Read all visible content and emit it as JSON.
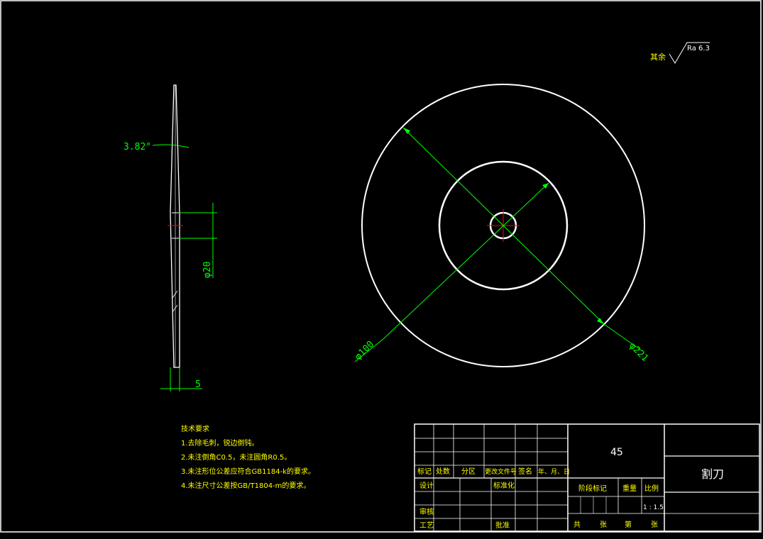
{
  "drawing": {
    "surface_finish": {
      "prefix": "其余",
      "value": "Ra 6.3"
    },
    "side_view": {
      "angle_label": "3.82°",
      "bore_label": "φ20",
      "thickness_label": "5"
    },
    "front_view": {
      "dia_inner_label": "φ100",
      "dia_outer_label": "φ221"
    },
    "tech_requirements": {
      "title": "技术要求",
      "lines": [
        "1.去除毛刺，锐边倒钝。",
        "2.未注倒角C0.5，未注圆角R0.5。",
        "3.未注形位公差应符合GB1184-k的要求。",
        "4.未注尺寸公差按GB/T1804-m的要求。"
      ]
    }
  },
  "title_block": {
    "material": "45",
    "part_name": "割刀",
    "rev_headers": [
      "标记",
      "处数",
      "分区",
      "更改文件号",
      "签名",
      "年、月、日"
    ],
    "design_label": "设计",
    "standard_label": "标准化",
    "check_label": "审核",
    "process_label": "工艺",
    "approve_label": "批准",
    "stage_label": "阶段标记",
    "weight_label": "重量",
    "scale_label": "比例",
    "scale_value": "1 : 1.5",
    "sheet": [
      "共",
      "张",
      "第",
      "张"
    ]
  },
  "colors": {
    "background": "#000000",
    "outline": "#ffffff",
    "dimension": "#00ff00",
    "text": "#ffff00",
    "center": "#ff0000"
  }
}
